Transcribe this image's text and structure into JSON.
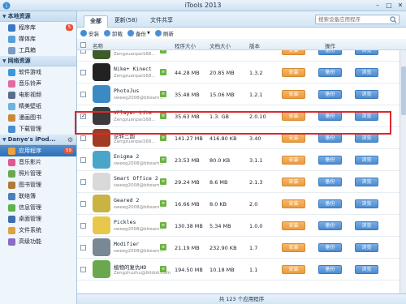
{
  "app": {
    "title": "iTools 2013"
  },
  "colors": {
    "accent": "#2f6fb4",
    "install_button": "#ec9a3b",
    "action_button": "#4c8bd0",
    "highlight_border": "#e0262a"
  },
  "sidebar": {
    "local_header": "本地资源",
    "local_items": [
      {
        "label": "程序库",
        "badge": "5",
        "icon": "app-library-icon"
      },
      {
        "label": "媒体库",
        "icon": "media-library-icon"
      },
      {
        "label": "工具箱",
        "icon": "toolbox-icon"
      }
    ],
    "online_header": "网络资源",
    "online_items": [
      {
        "label": "软件游戏",
        "icon": "software-games-icon"
      },
      {
        "label": "音乐铃声",
        "icon": "music-icon"
      },
      {
        "label": "电影视频",
        "icon": "movies-icon"
      },
      {
        "label": "精美壁纸",
        "icon": "wallpaper-icon"
      },
      {
        "label": "漫画图书",
        "icon": "books-icon"
      },
      {
        "label": "下载管理",
        "icon": "download-icon"
      }
    ],
    "device_header": "Danye's iPod...",
    "device_items": [
      {
        "label": "应用程序",
        "badge": "59",
        "icon": "apps-icon"
      },
      {
        "label": "音乐影片",
        "icon": "music-video-icon"
      },
      {
        "label": "照片管理",
        "icon": "photos-icon"
      },
      {
        "label": "图书管理",
        "icon": "ibooks-icon"
      },
      {
        "label": "联络簿",
        "icon": "contacts-icon"
      },
      {
        "label": "信息管理",
        "icon": "messages-icon"
      },
      {
        "label": "桌面管理",
        "icon": "desktop-icon"
      },
      {
        "label": "文件系统",
        "icon": "filesystem-icon"
      },
      {
        "label": "高级功能",
        "icon": "advanced-icon"
      }
    ]
  },
  "tabs": {
    "all": "全部",
    "updates": "更新(58)",
    "file_share": "文件共享"
  },
  "search": {
    "placeholder": "搜索设备应用程序"
  },
  "toolbar": {
    "install": "安装",
    "uninstall": "卸载",
    "backup": "备份",
    "refresh": "刷新"
  },
  "columns": {
    "name": "名称",
    "program_size": "程序大小",
    "doc_size": "文档大小",
    "version": "版本",
    "actions": "操作"
  },
  "buttons": {
    "install": "安装",
    "backup": "备份",
    "browse": "浏览"
  },
  "apps": [
    {
      "name": "",
      "author": "Zengzuanpai168...",
      "program_size": "",
      "doc_size": "",
      "version": ""
    },
    {
      "name": "Nike+ Kinect",
      "author": "Zengzuanpai168...",
      "program_size": "44.28 MB",
      "doc_size": "20.85 MB",
      "version": "1.3.2"
    },
    {
      "name": "PhotoJus",
      "author": "sweeg2008@biteam...",
      "program_size": "35.48 MB",
      "doc_size": "15.06 MB",
      "version": "1.2.1"
    },
    {
      "name": "VPlayer Lite",
      "author": "Zengzuanpai168...",
      "program_size": "35.63 MB",
      "doc_size": "1.3. GB",
      "version": "2.0.10",
      "checked": true
    },
    {
      "name": "逆转三国",
      "author": "Zengzuanpai168...",
      "program_size": "141.27 MB",
      "doc_size": "416.80 KB",
      "version": "3.40"
    },
    {
      "name": "Enigma 2",
      "author": "sweeg2008@biteam...",
      "program_size": "23.53 MB",
      "doc_size": "80.0 KB",
      "version": "3.1.1"
    },
    {
      "name": "Smart Office 2",
      "author": "sweeg2008@biteam...",
      "program_size": "29.24 MB",
      "doc_size": "8.6 MB",
      "version": "2.1.3"
    },
    {
      "name": "Geared 2",
      "author": "sweeg2008@biteam...",
      "program_size": "16.66 MB",
      "doc_size": "8.0 KB",
      "version": "2.0"
    },
    {
      "name": "Pickles",
      "author": "sweeg2008@biteam...",
      "program_size": "130.38 MB",
      "doc_size": "5.34 MB",
      "version": "1.0.0"
    },
    {
      "name": "Modifier",
      "author": "sweeg2008@biteam...",
      "program_size": "21.19 MB",
      "doc_size": "232.90 KB",
      "version": "1.7"
    },
    {
      "name": "植物的复仇HD",
      "author": "Zengzhuzhu@bitdok.com",
      "program_size": "194.50 MB",
      "doc_size": "10.18 MB",
      "version": "1.1"
    }
  ],
  "status": {
    "text": "共 123 个应用程序"
  }
}
